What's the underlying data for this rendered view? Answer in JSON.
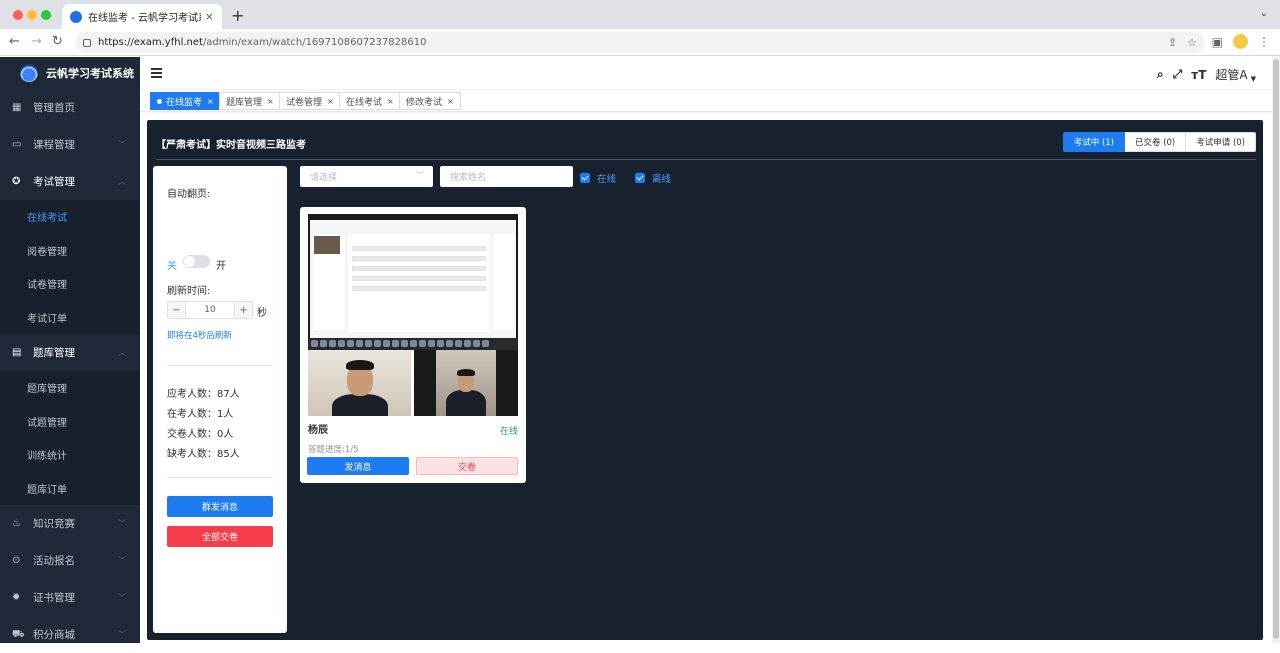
{
  "browser": {
    "tab_title": "在线监考 - 云帆学习考试系统",
    "tab_close": "×",
    "new_tab": "+",
    "url_host": "https://exam.yfhl.net",
    "url_path": "/admin/exam/watch/1697108607237828610"
  },
  "app": {
    "name": "云帆学习考试系统",
    "user": "超管A"
  },
  "sidebar": {
    "items": [
      {
        "label": "管理首页",
        "icon": "dashboard-icon"
      },
      {
        "label": "课程管理",
        "icon": "monitor-icon"
      },
      {
        "label": "考试管理",
        "icon": "exam-icon"
      },
      {
        "label": "题库管理",
        "icon": "document-icon"
      },
      {
        "label": "知识竞赛",
        "icon": "flame-icon"
      },
      {
        "label": "活动报名",
        "icon": "activity-icon"
      },
      {
        "label": "证书管理",
        "icon": "certificate-icon"
      },
      {
        "label": "积分商城",
        "icon": "cart-icon"
      }
    ],
    "exam_sub": [
      "在线考试",
      "阅卷管理",
      "试卷管理",
      "考试订单"
    ],
    "bank_sub": [
      "题库管理",
      "试题管理",
      "训练统计",
      "题库订单"
    ]
  },
  "tags": [
    {
      "label": "在线监考",
      "active": true
    },
    {
      "label": "题库管理"
    },
    {
      "label": "试卷管理"
    },
    {
      "label": "在线考试"
    },
    {
      "label": "修改考试"
    }
  ],
  "tag_close": "×",
  "panel": {
    "title": "【严肃考试】实时音视频三路监考",
    "segments": [
      "考试中 (1)",
      "已交卷 (0)",
      "考试申请 (0)"
    ]
  },
  "control": {
    "auto_page_label": "自动翻页:",
    "switch_off": "关",
    "switch_on": "开",
    "refresh_label": "刷新时间:",
    "refresh_value": "10",
    "minus": "−",
    "plus": "+",
    "unit": "秒",
    "refresh_note": "即将在4秒后刷新",
    "stats": [
      "应考人数：87人",
      "在考人数：1人",
      "交卷人数：0人",
      "缺考人数：85人"
    ],
    "broadcast_btn": "群发消息",
    "submit_all_btn": "全部交卷"
  },
  "filters": {
    "select_placeholder": "请选择",
    "search_placeholder": "搜索姓名",
    "online_label": "在线",
    "offline_label": "离线"
  },
  "candidate": {
    "name": "杨辰",
    "status": "在线",
    "progress": "答题进度:1/5",
    "send_btn": "发消息",
    "submit_btn": "交卷"
  }
}
